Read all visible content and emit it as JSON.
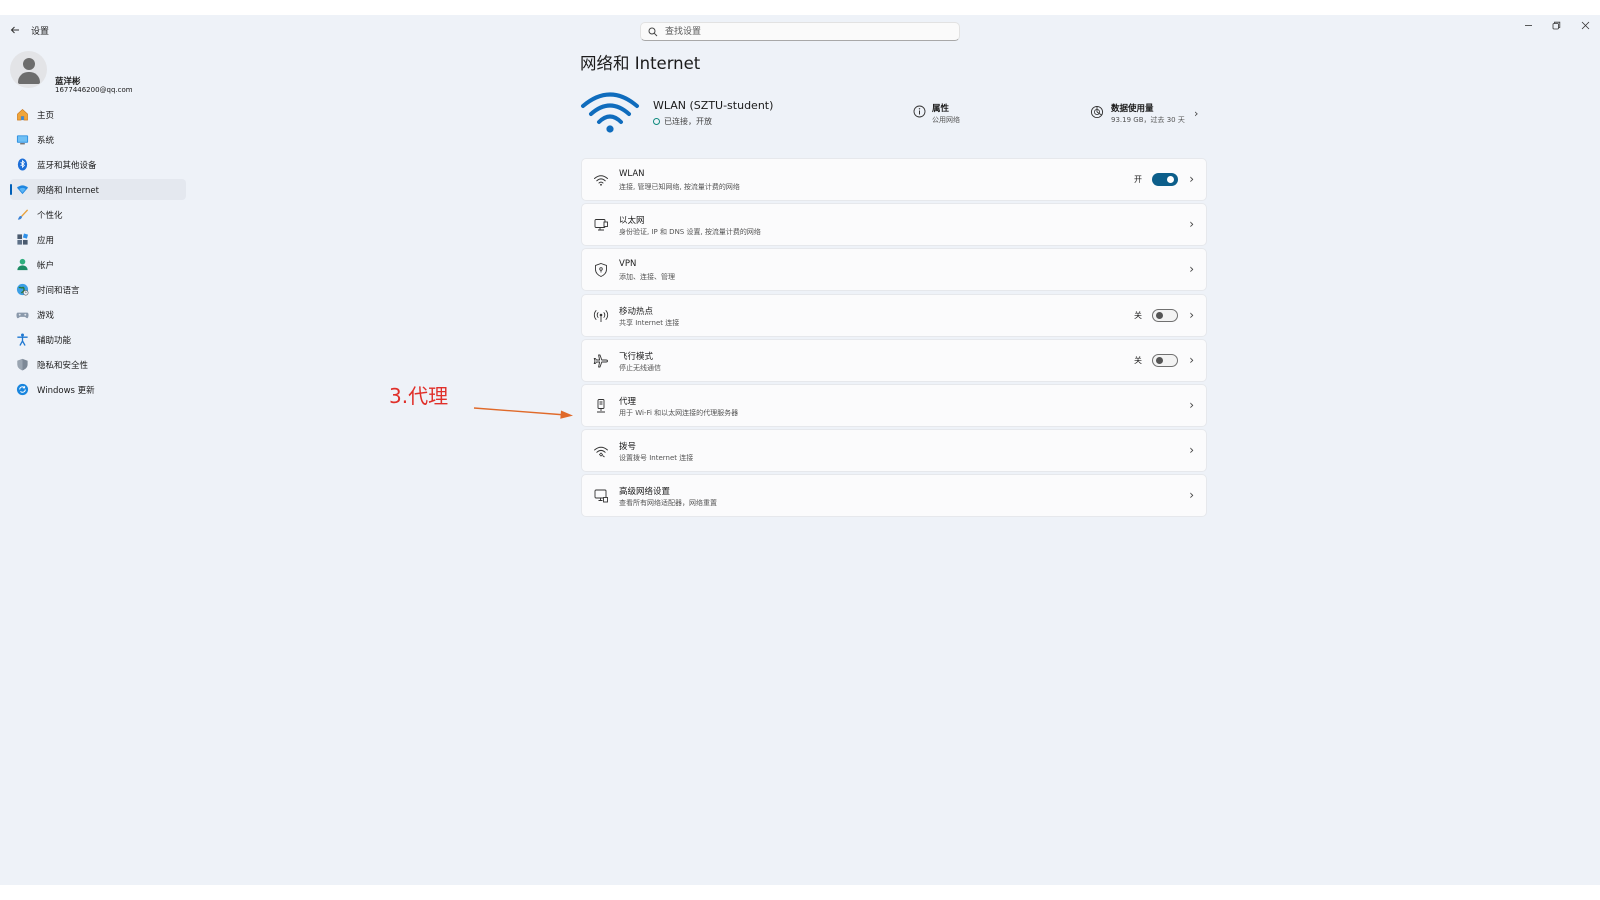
{
  "titlebar": {
    "back_icon": "arrow-left-icon",
    "app_title": "设置",
    "search_placeholder": "查找设置",
    "controls": [
      "minimize-icon",
      "restore-icon",
      "close-icon"
    ]
  },
  "profile": {
    "name": "蓝洋彬",
    "email": "1677446200@qq.com"
  },
  "sidebar": {
    "items": [
      {
        "label": "主页",
        "icon": "home-icon",
        "active": false
      },
      {
        "label": "系统",
        "icon": "system-icon",
        "active": false
      },
      {
        "label": "蓝牙和其他设备",
        "icon": "bluetooth-icon",
        "active": false
      },
      {
        "label": "网络和 Internet",
        "icon": "network-icon",
        "active": true
      },
      {
        "label": "个性化",
        "icon": "brush-icon",
        "active": false
      },
      {
        "label": "应用",
        "icon": "apps-icon",
        "active": false
      },
      {
        "label": "帐户",
        "icon": "account-icon",
        "active": false
      },
      {
        "label": "时间和语言",
        "icon": "time-language-icon",
        "active": false
      },
      {
        "label": "游戏",
        "icon": "gaming-icon",
        "active": false
      },
      {
        "label": "辅助功能",
        "icon": "accessibility-icon",
        "active": false
      },
      {
        "label": "隐私和安全性",
        "icon": "shield-icon",
        "active": false
      },
      {
        "label": "Windows 更新",
        "icon": "update-icon",
        "active": false
      }
    ]
  },
  "main": {
    "page_title": "网络和 Internet",
    "hero": {
      "network_name": "WLAN (SZTU-student)",
      "status": "已连接，开放",
      "properties_title": "属性",
      "properties_sub": "公用网络",
      "usage_title": "数据使用量",
      "usage_sub": "93.19 GB，过去 30 天"
    },
    "cards": [
      {
        "title": "WLAN",
        "subtitle": "连接, 管理已知网络, 按流量计费的网络",
        "icon": "wifi-icon",
        "toggle": "on",
        "state": "开"
      },
      {
        "title": "以太网",
        "subtitle": "身份验证, IP 和 DNS 设置, 按流量计费的网络",
        "icon": "ethernet-icon",
        "toggle": null,
        "state": ""
      },
      {
        "title": "VPN",
        "subtitle": "添加、连接、管理",
        "icon": "vpn-shield-icon",
        "toggle": null,
        "state": ""
      },
      {
        "title": "移动热点",
        "subtitle": "共享 Internet 连接",
        "icon": "hotspot-icon",
        "toggle": "off",
        "state": "关"
      },
      {
        "title": "飞行模式",
        "subtitle": "停止无线通信",
        "icon": "airplane-icon",
        "toggle": "off",
        "state": "关"
      },
      {
        "title": "代理",
        "subtitle": "用于 Wi-Fi 和以太网连接的代理服务器",
        "icon": "proxy-icon",
        "toggle": null,
        "state": ""
      },
      {
        "title": "拨号",
        "subtitle": "设置拨号 Internet 连接",
        "icon": "dialup-icon",
        "toggle": null,
        "state": ""
      },
      {
        "title": "高级网络设置",
        "subtitle": "查看所有网络适配器，网络重置",
        "icon": "advanced-network-icon",
        "toggle": null,
        "state": ""
      }
    ]
  },
  "annotation": {
    "label": "3.代理",
    "color": "#e0302a"
  },
  "colors": {
    "accent": "#005fb8",
    "toggle_on": "#0c5e8a",
    "window_bg": "#eef2f8"
  }
}
